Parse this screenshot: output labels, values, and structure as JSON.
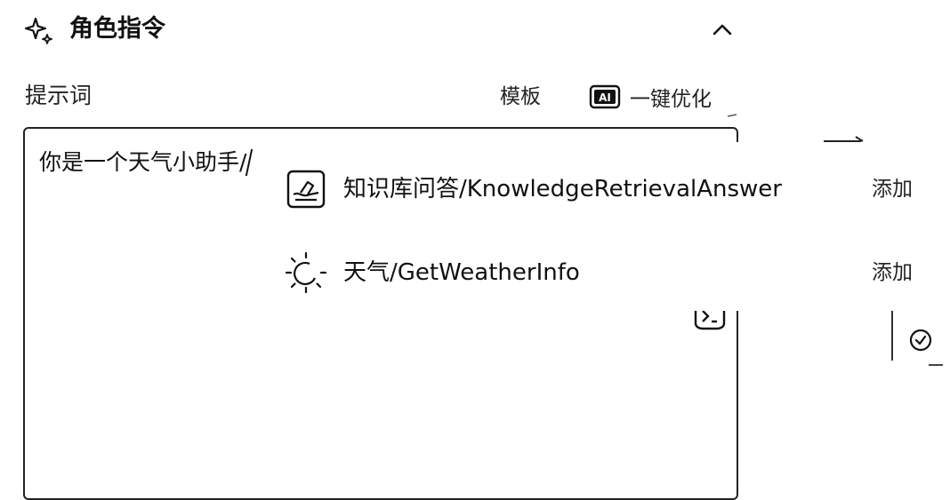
{
  "section": {
    "title": "角色指令",
    "collapse_icon": "chevron-up-icon",
    "icon": "sparkle-icon"
  },
  "prompt": {
    "label": "提示词",
    "template_label": "模板",
    "optimize_label": "一键优化",
    "optimize_icon": "ai-icon",
    "value": "你是一个天气小助手/"
  },
  "suggestions": {
    "items": [
      {
        "label": "知识库问答/KnowledgeRetrievalAnswer",
        "action": "添加",
        "icon": "knowledge-book-icon"
      },
      {
        "label": "天气/GetWeatherInfo",
        "action": "添加",
        "icon": "sun-weather-icon"
      }
    ]
  },
  "colors": {
    "text": "#111111",
    "border": "#222222",
    "background": "#ffffff"
  }
}
